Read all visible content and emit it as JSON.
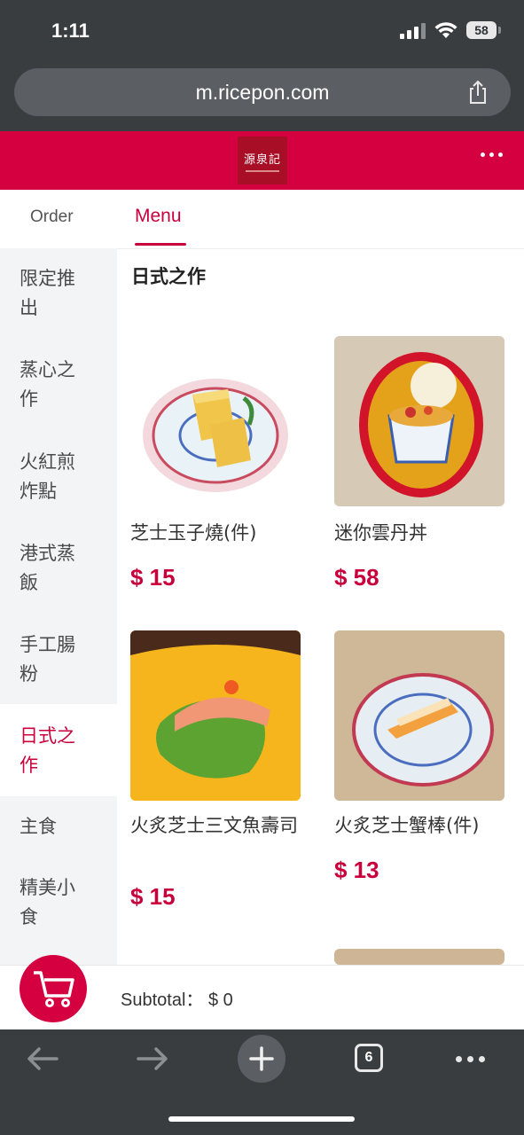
{
  "status_bar": {
    "time": "1:11",
    "battery": "58"
  },
  "browser": {
    "url": "m.ricepon.com",
    "tabs_count": "6"
  },
  "brand": {
    "logo_text": "源泉記",
    "accent": "#d4003f"
  },
  "tabs": [
    {
      "label": "Order"
    },
    {
      "label": "Menu"
    }
  ],
  "sidebar": {
    "categories": [
      {
        "label": "限定推出"
      },
      {
        "label": "蒸心之作"
      },
      {
        "label": "火紅煎炸點"
      },
      {
        "label": "港式蒸飯"
      },
      {
        "label": "手工腸粉"
      },
      {
        "label": "日式之作"
      },
      {
        "label": "主食"
      },
      {
        "label": "精美小食"
      }
    ],
    "active_index": 5
  },
  "section": {
    "title": "日式之作"
  },
  "items": [
    {
      "name": "芝士玉子燒(件)",
      "price": "$ 15",
      "icon": "tamagoyaki-plate"
    },
    {
      "name": "迷你雲丹丼",
      "price": "$ 58",
      "icon": "uni-bowl"
    },
    {
      "name": "火炙芝士三文魚壽司",
      "price": "$ 15",
      "icon": "salmon-sushi-leaf"
    },
    {
      "name": "火炙芝士蟹棒(件)",
      "price": "$ 13",
      "icon": "crab-stick-plate"
    }
  ],
  "cart": {
    "subtotal_label": "Subtotal：",
    "subtotal_value": "$ 0"
  }
}
